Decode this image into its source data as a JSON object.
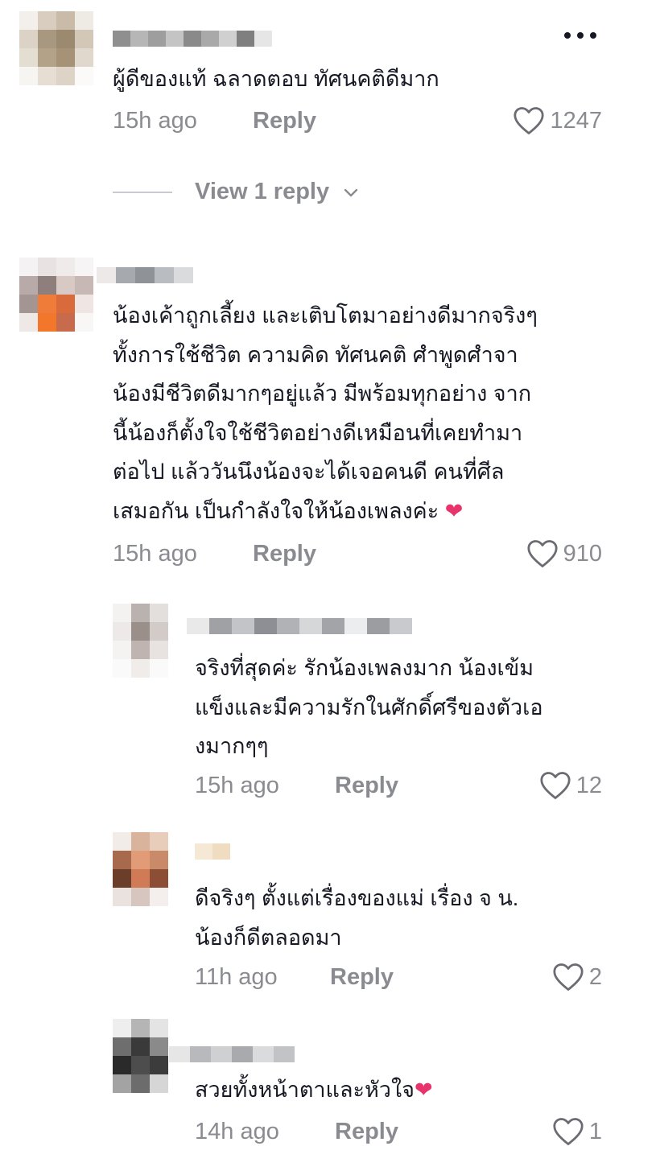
{
  "comments": [
    {
      "text_lines": [
        "ผู้ดีของแท้ ฉลาดตอบ ทัศนคติดีมาก"
      ],
      "time": "15h ago",
      "reply_label": "Reply",
      "likes": "1247",
      "view_replies": "View 1 reply"
    },
    {
      "text_lines": [
        "น้องเค้าถูกเลี้ยง และเติบโตมาอย่างดีมากจริงๆ",
        "ทั้งการใช้ชีวิต ความคิด ทัศนคติ ศำพูดศำจา",
        "น้องมีชีวิตดีมากๆอยู่แล้ว มีพร้อมทุกอย่าง จาก",
        "นี้น้องก็ตั้งใจใช้ชีวิตอย่างดีเหมือนที่เคยทำมา",
        "ต่อไป แล้ววันนึงน้องจะได้เจอคนดี คนที่ศีล",
        "เสมอกัน เป็นกำลังใจให้น้องเพลงค่ะ"
      ],
      "emoji": "❤",
      "time": "15h ago",
      "reply_label": "Reply",
      "likes": "910"
    }
  ],
  "replies": [
    {
      "text_lines": [
        "จริงที่สุดค่ะ รักน้องเพลงมาก น้องเข้ม",
        "แข็งและมีความรักในศักดิ์ศรีของตัวเอ",
        "งมากๆๆ"
      ],
      "time": "15h ago",
      "reply_label": "Reply",
      "likes": "12"
    },
    {
      "text_lines": [
        "ดีจริงๆ ตั้งแต่เรื่องของแม่ เรื่อง จ น.",
        "น้องก็ดีตลอดมา"
      ],
      "time": "11h ago",
      "reply_label": "Reply",
      "likes": "2"
    },
    {
      "text_lines": [
        "สวยทั้งหน้าตาและหัวใจ"
      ],
      "emoji": "❤",
      "time": "14h ago",
      "reply_label": "Reply",
      "likes": "1"
    }
  ],
  "more_icon": "…",
  "icons": {
    "like": "heart-outline-icon",
    "more": "more-dots-icon",
    "expand": "chevron-down-icon"
  },
  "colors": {
    "text": "#161823",
    "meta": "#8a8b91",
    "emoji": "#e8336d"
  }
}
